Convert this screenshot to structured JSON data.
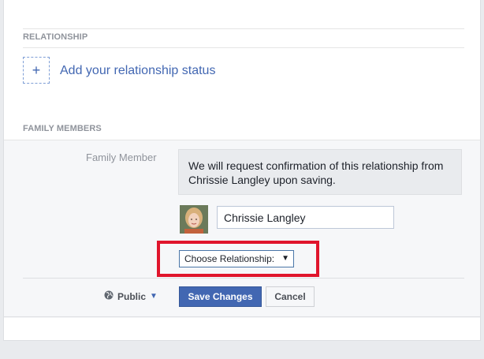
{
  "relationship": {
    "heading": "RELATIONSHIP",
    "add_icon": "+",
    "add_label": "Add your relationship status"
  },
  "family": {
    "heading": "FAMILY MEMBERS",
    "field_label": "Family Member",
    "notice": "We will request confirmation of this relationship from Chrissie Langley upon saving.",
    "member_name": "Chrissie Langley",
    "relationship_select": "Choose Relationship:",
    "select_arrow": "▼"
  },
  "footer": {
    "privacy_label": "Public",
    "privacy_icon": "globe-icon",
    "save_label": "Save Changes",
    "cancel_label": "Cancel"
  },
  "colors": {
    "link": "#4267b2",
    "highlight": "#e0152c"
  }
}
